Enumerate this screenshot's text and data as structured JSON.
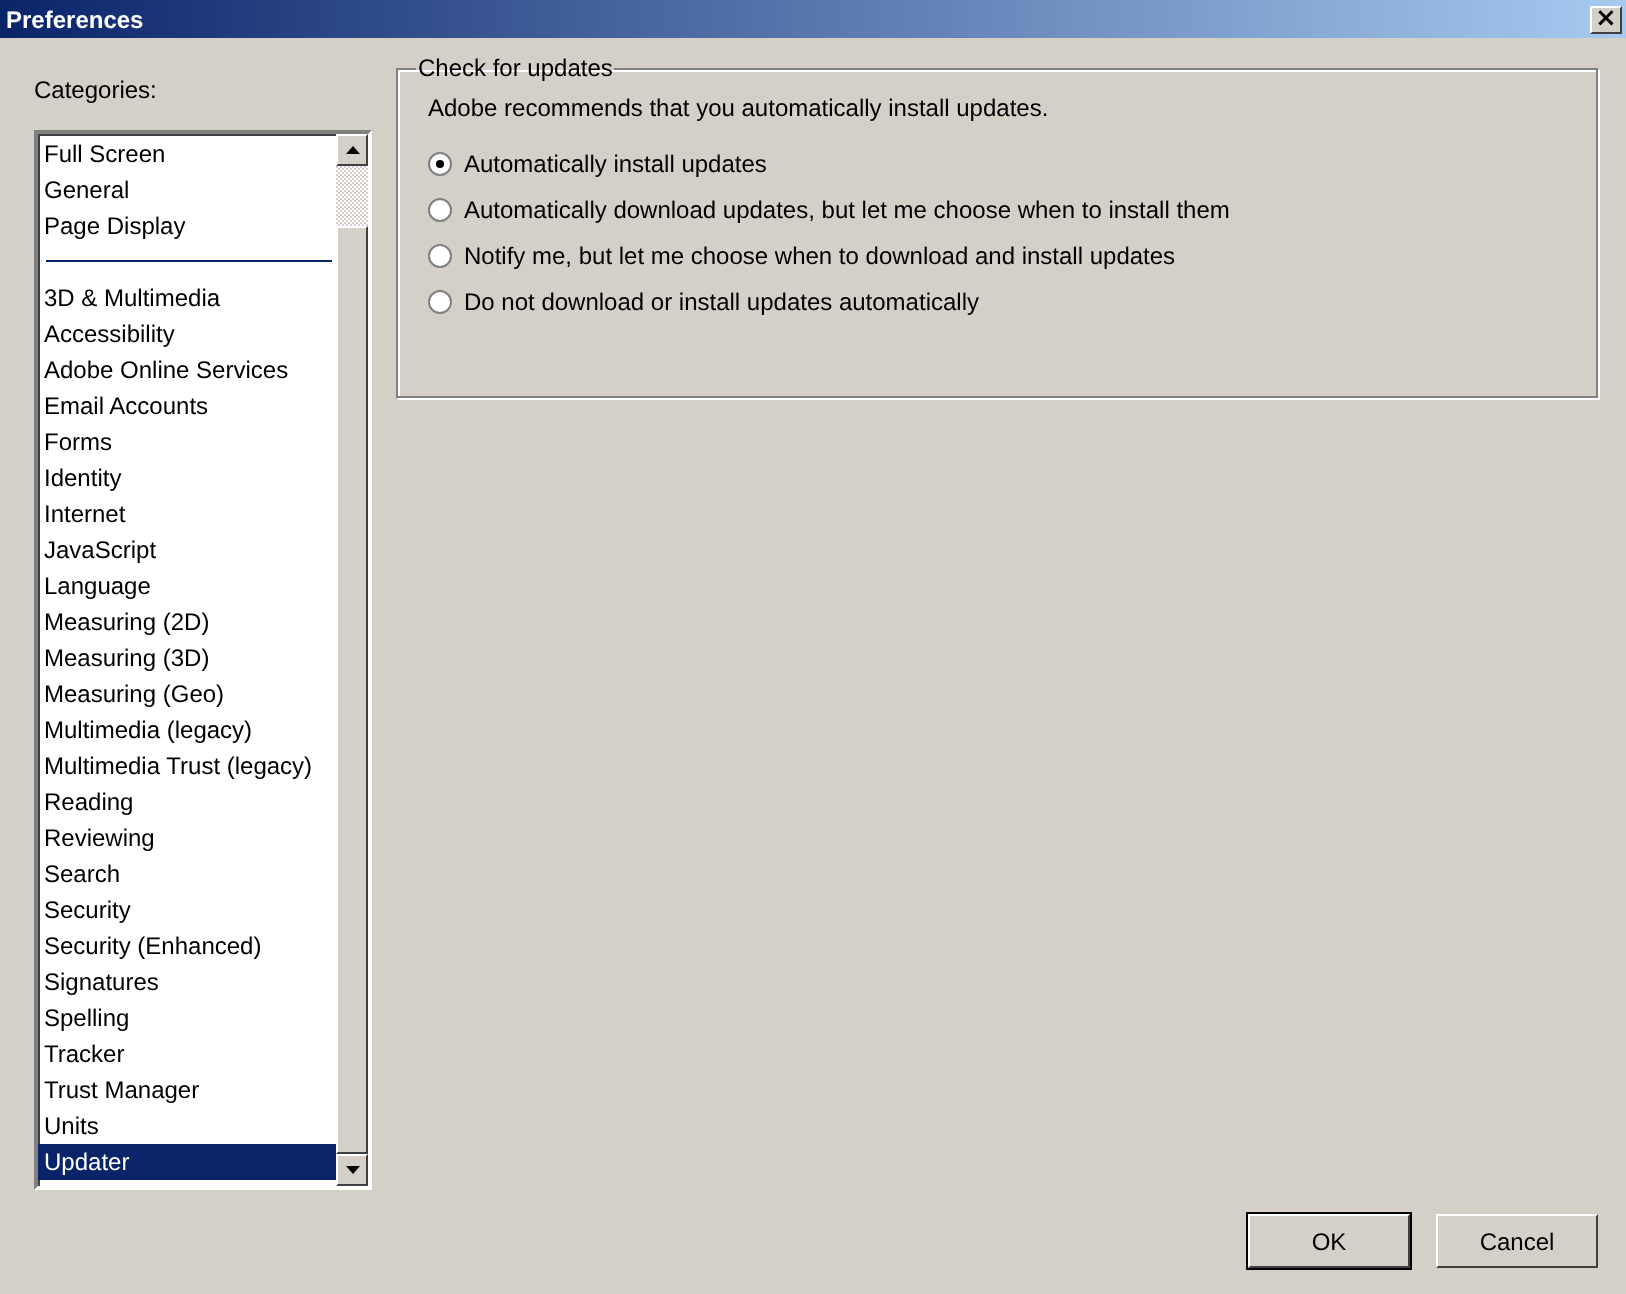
{
  "window": {
    "title": "Preferences",
    "close_label": "×"
  },
  "categories": {
    "label": "Categories:",
    "pinned": [
      {
        "label": "Full Screen",
        "selected": false
      },
      {
        "label": "General",
        "selected": false
      },
      {
        "label": "Page Display",
        "selected": false
      }
    ],
    "items": [
      {
        "label": "3D & Multimedia",
        "selected": false
      },
      {
        "label": "Accessibility",
        "selected": false
      },
      {
        "label": "Adobe Online Services",
        "selected": false
      },
      {
        "label": "Email Accounts",
        "selected": false
      },
      {
        "label": "Forms",
        "selected": false
      },
      {
        "label": "Identity",
        "selected": false
      },
      {
        "label": "Internet",
        "selected": false
      },
      {
        "label": "JavaScript",
        "selected": false
      },
      {
        "label": "Language",
        "selected": false
      },
      {
        "label": "Measuring (2D)",
        "selected": false
      },
      {
        "label": "Measuring (3D)",
        "selected": false
      },
      {
        "label": "Measuring (Geo)",
        "selected": false
      },
      {
        "label": "Multimedia (legacy)",
        "selected": false
      },
      {
        "label": "Multimedia Trust (legacy)",
        "selected": false
      },
      {
        "label": "Reading",
        "selected": false
      },
      {
        "label": "Reviewing",
        "selected": false
      },
      {
        "label": "Search",
        "selected": false
      },
      {
        "label": "Security",
        "selected": false
      },
      {
        "label": "Security (Enhanced)",
        "selected": false
      },
      {
        "label": "Signatures",
        "selected": false
      },
      {
        "label": "Spelling",
        "selected": false
      },
      {
        "label": "Tracker",
        "selected": false
      },
      {
        "label": "Trust Manager",
        "selected": false
      },
      {
        "label": "Units",
        "selected": false
      },
      {
        "label": "Updater",
        "selected": true
      }
    ]
  },
  "updates": {
    "title": "Check for updates",
    "note": "Adobe recommends that you automatically install updates.",
    "options": [
      {
        "label": "Automatically install updates",
        "selected": true
      },
      {
        "label": "Automatically download updates, but let me choose when to install them",
        "selected": false
      },
      {
        "label": "Notify me, but let me choose when to download and install updates",
        "selected": false
      },
      {
        "label": "Do not download or install updates automatically",
        "selected": false
      }
    ]
  },
  "buttons": [
    {
      "label": "OK",
      "default": true
    },
    {
      "label": "Cancel",
      "default": false
    }
  ]
}
